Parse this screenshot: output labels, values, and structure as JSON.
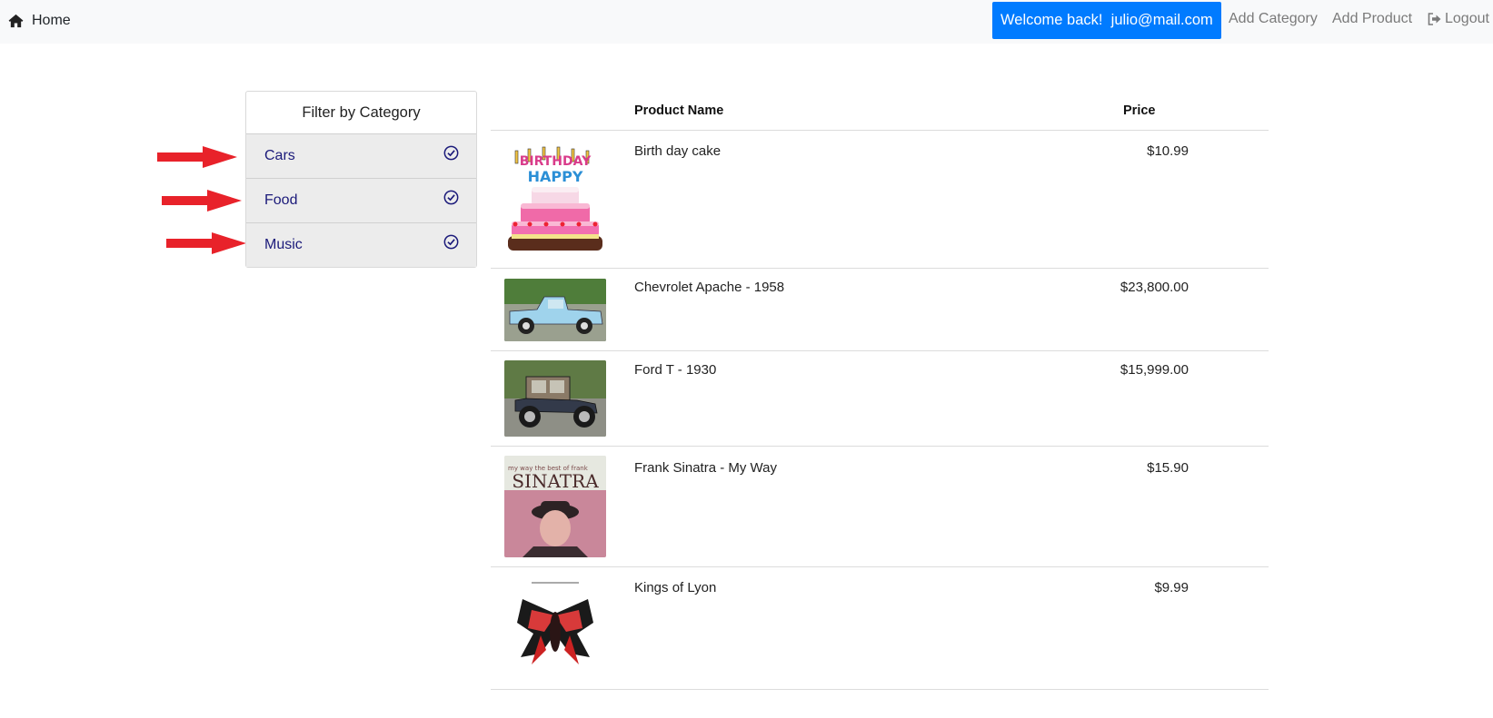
{
  "navbar": {
    "home_label": "Home",
    "welcome_text": "Welcome back!  julio@mail.com",
    "add_category_label": "Add Category",
    "add_product_label": "Add Product",
    "logout_label": "Logout"
  },
  "filter": {
    "title": "Filter by Category",
    "categories": [
      {
        "label": "Cars",
        "selected": true
      },
      {
        "label": "Food",
        "selected": true
      },
      {
        "label": "Music",
        "selected": true
      }
    ]
  },
  "table": {
    "headers": {
      "name": "Product Name",
      "price": "Price"
    },
    "rows": [
      {
        "name": "Birth day cake",
        "price": "$10.99",
        "image": "birthday-cake-image"
      },
      {
        "name": "Chevrolet Apache - 1958",
        "price": "$23,800.00",
        "image": "blue-pickup-truck-image"
      },
      {
        "name": "Ford T - 1930",
        "price": "$15,999.00",
        "image": "vintage-car-image"
      },
      {
        "name": "Frank Sinatra - My Way",
        "price": "$15.90",
        "image": "sinatra-album-cover-image"
      },
      {
        "name": "Kings of Lyon",
        "price": "$9.99",
        "image": "kings-of-leon-album-cover-image"
      }
    ]
  },
  "colors": {
    "navbar_bg": "#f8f9fa",
    "welcome_bg": "#007bff",
    "category_text": "#1b1a7a",
    "annotation_arrow": "#e8222a"
  },
  "image_text": {
    "birthday_cake": "HAPPY BIRTHDAY",
    "sinatra_album": "SINATRA",
    "sinatra_subtitle": "my way the best of frank"
  }
}
